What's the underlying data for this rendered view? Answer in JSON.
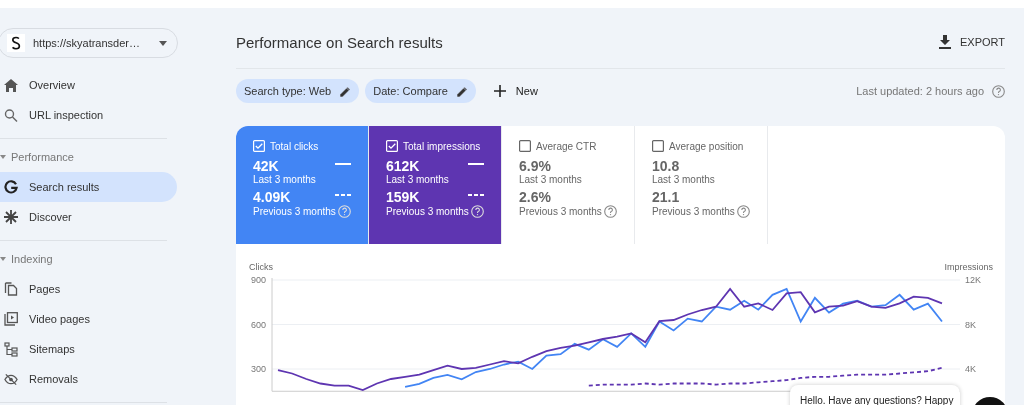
{
  "property": {
    "url": "https://skyatransder…"
  },
  "nav": {
    "items": [
      {
        "label": "Overview",
        "selected": false
      },
      {
        "label": "URL inspection",
        "selected": false
      }
    ],
    "sections": [
      {
        "title": "Performance",
        "expanded": true,
        "items": [
          {
            "label": "Search results",
            "selected": true
          },
          {
            "label": "Discover",
            "selected": false
          }
        ]
      },
      {
        "title": "Indexing",
        "expanded": true,
        "items": [
          {
            "label": "Pages",
            "selected": false
          },
          {
            "label": "Video pages",
            "selected": false
          },
          {
            "label": "Sitemaps",
            "selected": false
          },
          {
            "label": "Removals",
            "selected": false
          }
        ]
      }
    ]
  },
  "header": {
    "title": "Performance on Search results",
    "export": "EXPORT"
  },
  "filters": {
    "chips": [
      "Search type: Web",
      "Date: Compare"
    ],
    "new": "New",
    "last_updated": "Last updated: 2 hours ago"
  },
  "metrics": [
    {
      "label": "Total clicks",
      "selected": true,
      "color": "#4285f4",
      "value": "42K",
      "period": "Last 3 months",
      "prev_value": "4.09K",
      "prev_period": "Previous 3 months"
    },
    {
      "label": "Total impressions",
      "selected": true,
      "color": "#5e35b1",
      "value": "612K",
      "period": "Last 3 months",
      "prev_value": "159K",
      "prev_period": "Previous 3 months"
    },
    {
      "label": "Average CTR",
      "selected": false,
      "value": "6.9%",
      "period": "Last 3 months",
      "prev_value": "2.6%",
      "prev_period": "Previous 3 months"
    },
    {
      "label": "Average position",
      "selected": false,
      "value": "10.8",
      "period": "Last 3 months",
      "prev_value": "21.1",
      "prev_period": "Previous 3 months"
    }
  ],
  "chart_data": {
    "type": "line",
    "ylabel": "Clicks",
    "y2label": "Impressions",
    "ylim": [
      150,
      900
    ],
    "y2lim": [
      2000,
      12000
    ],
    "yticks": [
      300,
      600,
      900
    ],
    "y2ticks": [
      {
        "value": 4000,
        "label": "4K"
      },
      {
        "value": 8000,
        "label": "8K"
      },
      {
        "value": 12000,
        "label": "12K"
      }
    ],
    "series": [
      {
        "color": "#4285f4",
        "line_style": "solid",
        "values": [
          null,
          null,
          null,
          null,
          null,
          null,
          null,
          null,
          null,
          180,
          200,
          240,
          260,
          230,
          280,
          300,
          330,
          350,
          300,
          390,
          400,
          470,
          430,
          500,
          450,
          540,
          450,
          620,
          560,
          640,
          620,
          720,
          700,
          760,
          700,
          800,
          840,
          620,
          780,
          680,
          740,
          760,
          720,
          730,
          800,
          700,
          740,
          620
        ]
      },
      {
        "color": "#5e35b1",
        "axis": "y2",
        "line_style": "solid",
        "values": [
          3900,
          3600,
          3100,
          2700,
          2500,
          2500,
          2100,
          2700,
          3100,
          3300,
          3500,
          3900,
          4300,
          4000,
          4100,
          4400,
          4700,
          4500,
          5100,
          5600,
          5900,
          6100,
          6400,
          6700,
          6900,
          7200,
          6400,
          8300,
          8400,
          8900,
          9300,
          9600,
          11200,
          9600,
          9900,
          9300,
          10800,
          10900,
          9100,
          9600,
          9700,
          10100,
          9600,
          9500,
          9900,
          10500,
          10400,
          9900
        ]
      },
      {
        "color": "#5e35b1",
        "axis": "y2",
        "line_style": "dashed",
        "values": [
          null,
          null,
          null,
          null,
          null,
          null,
          null,
          null,
          null,
          null,
          null,
          null,
          null,
          null,
          null,
          null,
          null,
          null,
          null,
          null,
          null,
          null,
          2500,
          2600,
          2600,
          2600,
          2700,
          2600,
          2700,
          2700,
          2700,
          2600,
          2700,
          2700,
          2800,
          2900,
          3000,
          3200,
          3300,
          3300,
          3400,
          3500,
          3500,
          3500,
          3600,
          3700,
          3800,
          4100
        ]
      }
    ]
  },
  "chat": {
    "text": "Hello. Have any questions? Happy"
  }
}
